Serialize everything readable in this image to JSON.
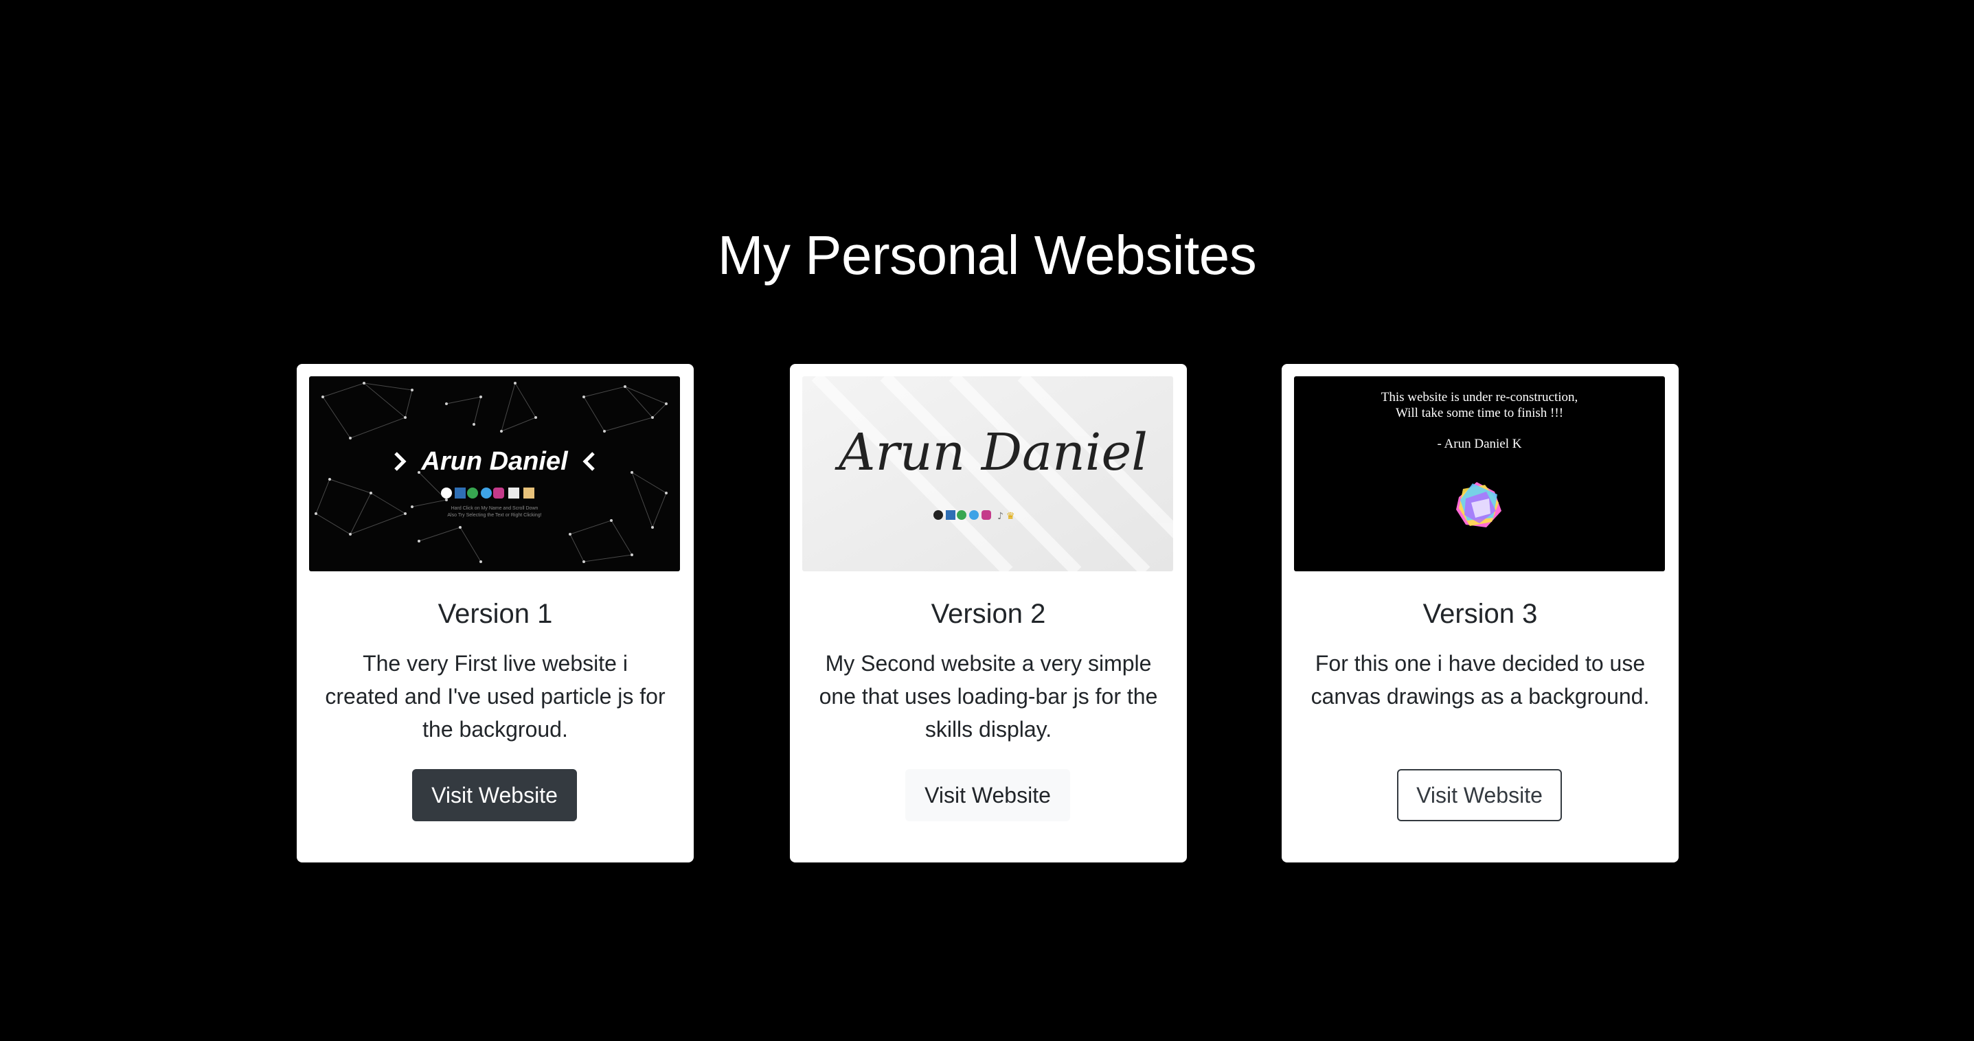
{
  "page": {
    "title": "My Personal Websites"
  },
  "colors": {
    "background": "#000000",
    "card": "#ffffff",
    "dark_button": "#343a40",
    "light_button": "#f8f9fa",
    "text": "#212529"
  },
  "cards": [
    {
      "title": "Version 1",
      "description": "The very First live website i created and I've used particle js for the backgroud.",
      "button_label": "Visit Website",
      "button_style": "dark",
      "thumbnail": {
        "name": "Arun Daniel",
        "caption_line1": "Hard Click on My Name and Scroll Down",
        "caption_line2": "Also Try Selecting the Text or Right Clicking!",
        "icons": [
          "github-icon",
          "linkedin-icon",
          "upwork-icon",
          "twitter-icon",
          "instagram-icon",
          "cv-icon",
          "bag-icon"
        ]
      }
    },
    {
      "title": "Version 2",
      "description": "My Second website a very simple one that uses loading-bar js for the skills display.",
      "button_label": "Visit Website",
      "button_style": "light",
      "thumbnail": {
        "name": "Arun Daniel",
        "icons": [
          "github-icon",
          "linkedin-icon",
          "upwork-icon",
          "twitter-icon",
          "instagram-icon",
          "music-icon",
          "crown-icon"
        ]
      }
    },
    {
      "title": "Version 3",
      "description": "For this one i have decided to use canvas drawings as a background.",
      "button_label": "Visit Website",
      "button_style": "outline",
      "thumbnail": {
        "line1": "This website is under re-construction,",
        "line2": "Will take some time to finish !!!",
        "signature": "- Arun Daniel K"
      }
    }
  ]
}
